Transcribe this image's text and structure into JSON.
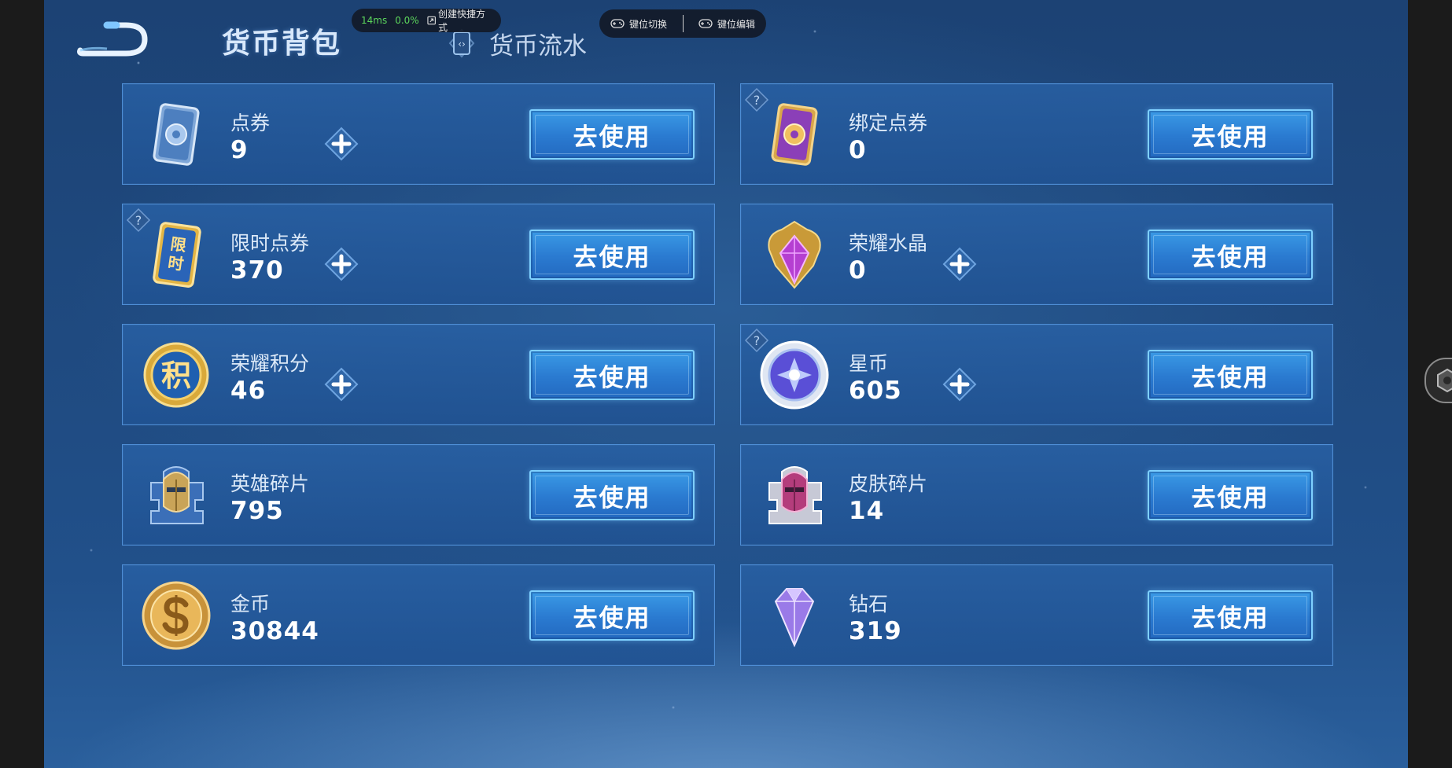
{
  "header": {
    "title": "货币背包",
    "flow_tab": "货币流水"
  },
  "overlay": {
    "latency": "14ms",
    "loss": "0.0%",
    "shortcut": "创建快捷方式",
    "key_switch": "键位切换",
    "key_edit": "键位编辑"
  },
  "currencies": [
    {
      "name": "点券",
      "amount": "9",
      "action": "去使用",
      "icon": "ticket-blue-icon",
      "plus": true,
      "help": false
    },
    {
      "name": "绑定点券",
      "amount": "0",
      "action": "去使用",
      "icon": "ticket-purple-icon",
      "plus": false,
      "help": true
    },
    {
      "name": "限时点券",
      "amount": "370",
      "action": "去使用",
      "icon": "limited-ticket-icon",
      "plus": true,
      "help": true
    },
    {
      "name": "荣耀水晶",
      "amount": "0",
      "action": "去使用",
      "icon": "glory-crystal-icon",
      "plus": true,
      "help": false
    },
    {
      "name": "荣耀积分",
      "amount": "46",
      "action": "去使用",
      "icon": "glory-points-icon",
      "plus": true,
      "help": false
    },
    {
      "name": "星币",
      "amount": "605",
      "action": "去使用",
      "icon": "star-coin-icon",
      "plus": true,
      "help": true
    },
    {
      "name": "英雄碎片",
      "amount": "795",
      "action": "去使用",
      "icon": "hero-fragment-icon",
      "plus": false,
      "help": false
    },
    {
      "name": "皮肤碎片",
      "amount": "14",
      "action": "去使用",
      "icon": "skin-fragment-icon",
      "plus": false,
      "help": false
    },
    {
      "name": "金币",
      "amount": "30844",
      "action": "去使用",
      "icon": "gold-coin-icon",
      "plus": false,
      "help": false
    },
    {
      "name": "钻石",
      "amount": "319",
      "action": "去使用",
      "icon": "diamond-icon",
      "plus": false,
      "help": false
    }
  ],
  "icon_labels": {
    "limited": "限时",
    "points": "积"
  },
  "colors": {
    "card_border": "#4e8ed6",
    "button": "#2a7ad0",
    "button_border": "#7fd0ff"
  }
}
